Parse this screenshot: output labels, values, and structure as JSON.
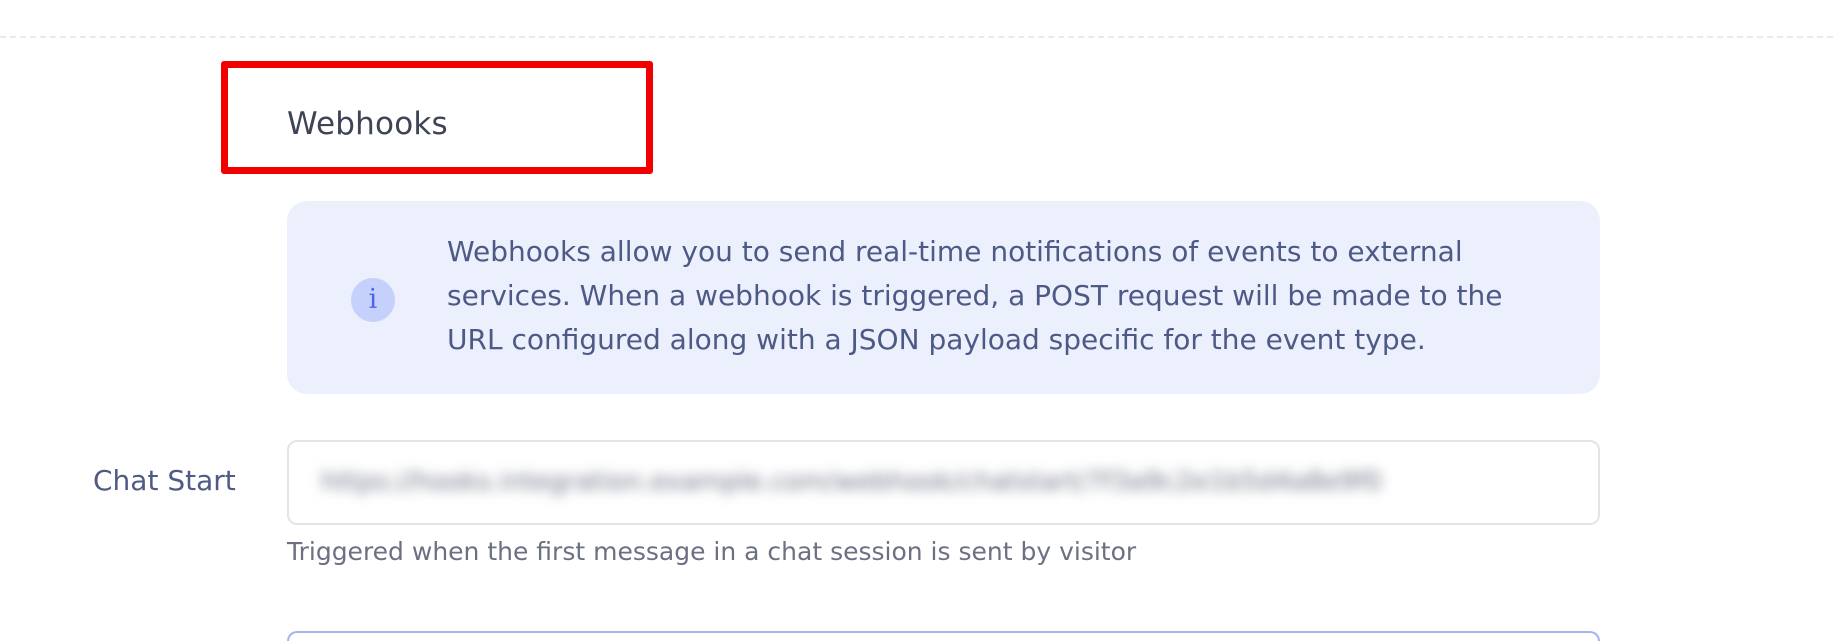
{
  "section": {
    "title": "Webhooks"
  },
  "info_banner": {
    "icon": "info-icon",
    "icon_glyph": "i",
    "text": "Webhooks allow you to send real-time notifications of events to external services. When a webhook is triggered, a POST request will be made to the URL configured along with a JSON payload specific for the event type."
  },
  "fields": {
    "chat_start": {
      "label": "Chat Start",
      "value": "https://hooks.integration.example.com/webhook/chatstart/7f3a9c2e1b5d4a8e9f0c",
      "help": "Triggered when the first message in a chat session is sent by visitor"
    }
  },
  "colors": {
    "highlight": "#f20000",
    "banner_bg": "#ecf0fd",
    "accent": "#4f64e8"
  }
}
